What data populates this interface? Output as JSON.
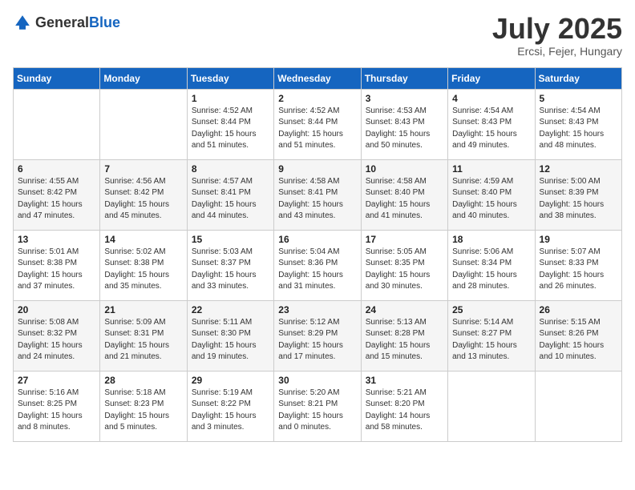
{
  "header": {
    "logo_general": "General",
    "logo_blue": "Blue",
    "month_title": "July 2025",
    "location": "Ercsi, Fejer, Hungary"
  },
  "days_of_week": [
    "Sunday",
    "Monday",
    "Tuesday",
    "Wednesday",
    "Thursday",
    "Friday",
    "Saturday"
  ],
  "weeks": [
    [
      {
        "day": "",
        "sunrise": "",
        "sunset": "",
        "daylight": ""
      },
      {
        "day": "",
        "sunrise": "",
        "sunset": "",
        "daylight": ""
      },
      {
        "day": "1",
        "sunrise": "Sunrise: 4:52 AM",
        "sunset": "Sunset: 8:44 PM",
        "daylight": "Daylight: 15 hours and 51 minutes."
      },
      {
        "day": "2",
        "sunrise": "Sunrise: 4:52 AM",
        "sunset": "Sunset: 8:44 PM",
        "daylight": "Daylight: 15 hours and 51 minutes."
      },
      {
        "day": "3",
        "sunrise": "Sunrise: 4:53 AM",
        "sunset": "Sunset: 8:43 PM",
        "daylight": "Daylight: 15 hours and 50 minutes."
      },
      {
        "day": "4",
        "sunrise": "Sunrise: 4:54 AM",
        "sunset": "Sunset: 8:43 PM",
        "daylight": "Daylight: 15 hours and 49 minutes."
      },
      {
        "day": "5",
        "sunrise": "Sunrise: 4:54 AM",
        "sunset": "Sunset: 8:43 PM",
        "daylight": "Daylight: 15 hours and 48 minutes."
      }
    ],
    [
      {
        "day": "6",
        "sunrise": "Sunrise: 4:55 AM",
        "sunset": "Sunset: 8:42 PM",
        "daylight": "Daylight: 15 hours and 47 minutes."
      },
      {
        "day": "7",
        "sunrise": "Sunrise: 4:56 AM",
        "sunset": "Sunset: 8:42 PM",
        "daylight": "Daylight: 15 hours and 45 minutes."
      },
      {
        "day": "8",
        "sunrise": "Sunrise: 4:57 AM",
        "sunset": "Sunset: 8:41 PM",
        "daylight": "Daylight: 15 hours and 44 minutes."
      },
      {
        "day": "9",
        "sunrise": "Sunrise: 4:58 AM",
        "sunset": "Sunset: 8:41 PM",
        "daylight": "Daylight: 15 hours and 43 minutes."
      },
      {
        "day": "10",
        "sunrise": "Sunrise: 4:58 AM",
        "sunset": "Sunset: 8:40 PM",
        "daylight": "Daylight: 15 hours and 41 minutes."
      },
      {
        "day": "11",
        "sunrise": "Sunrise: 4:59 AM",
        "sunset": "Sunset: 8:40 PM",
        "daylight": "Daylight: 15 hours and 40 minutes."
      },
      {
        "day": "12",
        "sunrise": "Sunrise: 5:00 AM",
        "sunset": "Sunset: 8:39 PM",
        "daylight": "Daylight: 15 hours and 38 minutes."
      }
    ],
    [
      {
        "day": "13",
        "sunrise": "Sunrise: 5:01 AM",
        "sunset": "Sunset: 8:38 PM",
        "daylight": "Daylight: 15 hours and 37 minutes."
      },
      {
        "day": "14",
        "sunrise": "Sunrise: 5:02 AM",
        "sunset": "Sunset: 8:38 PM",
        "daylight": "Daylight: 15 hours and 35 minutes."
      },
      {
        "day": "15",
        "sunrise": "Sunrise: 5:03 AM",
        "sunset": "Sunset: 8:37 PM",
        "daylight": "Daylight: 15 hours and 33 minutes."
      },
      {
        "day": "16",
        "sunrise": "Sunrise: 5:04 AM",
        "sunset": "Sunset: 8:36 PM",
        "daylight": "Daylight: 15 hours and 31 minutes."
      },
      {
        "day": "17",
        "sunrise": "Sunrise: 5:05 AM",
        "sunset": "Sunset: 8:35 PM",
        "daylight": "Daylight: 15 hours and 30 minutes."
      },
      {
        "day": "18",
        "sunrise": "Sunrise: 5:06 AM",
        "sunset": "Sunset: 8:34 PM",
        "daylight": "Daylight: 15 hours and 28 minutes."
      },
      {
        "day": "19",
        "sunrise": "Sunrise: 5:07 AM",
        "sunset": "Sunset: 8:33 PM",
        "daylight": "Daylight: 15 hours and 26 minutes."
      }
    ],
    [
      {
        "day": "20",
        "sunrise": "Sunrise: 5:08 AM",
        "sunset": "Sunset: 8:32 PM",
        "daylight": "Daylight: 15 hours and 24 minutes."
      },
      {
        "day": "21",
        "sunrise": "Sunrise: 5:09 AM",
        "sunset": "Sunset: 8:31 PM",
        "daylight": "Daylight: 15 hours and 21 minutes."
      },
      {
        "day": "22",
        "sunrise": "Sunrise: 5:11 AM",
        "sunset": "Sunset: 8:30 PM",
        "daylight": "Daylight: 15 hours and 19 minutes."
      },
      {
        "day": "23",
        "sunrise": "Sunrise: 5:12 AM",
        "sunset": "Sunset: 8:29 PM",
        "daylight": "Daylight: 15 hours and 17 minutes."
      },
      {
        "day": "24",
        "sunrise": "Sunrise: 5:13 AM",
        "sunset": "Sunset: 8:28 PM",
        "daylight": "Daylight: 15 hours and 15 minutes."
      },
      {
        "day": "25",
        "sunrise": "Sunrise: 5:14 AM",
        "sunset": "Sunset: 8:27 PM",
        "daylight": "Daylight: 15 hours and 13 minutes."
      },
      {
        "day": "26",
        "sunrise": "Sunrise: 5:15 AM",
        "sunset": "Sunset: 8:26 PM",
        "daylight": "Daylight: 15 hours and 10 minutes."
      }
    ],
    [
      {
        "day": "27",
        "sunrise": "Sunrise: 5:16 AM",
        "sunset": "Sunset: 8:25 PM",
        "daylight": "Daylight: 15 hours and 8 minutes."
      },
      {
        "day": "28",
        "sunrise": "Sunrise: 5:18 AM",
        "sunset": "Sunset: 8:23 PM",
        "daylight": "Daylight: 15 hours and 5 minutes."
      },
      {
        "day": "29",
        "sunrise": "Sunrise: 5:19 AM",
        "sunset": "Sunset: 8:22 PM",
        "daylight": "Daylight: 15 hours and 3 minutes."
      },
      {
        "day": "30",
        "sunrise": "Sunrise: 5:20 AM",
        "sunset": "Sunset: 8:21 PM",
        "daylight": "Daylight: 15 hours and 0 minutes."
      },
      {
        "day": "31",
        "sunrise": "Sunrise: 5:21 AM",
        "sunset": "Sunset: 8:20 PM",
        "daylight": "Daylight: 14 hours and 58 minutes."
      },
      {
        "day": "",
        "sunrise": "",
        "sunset": "",
        "daylight": ""
      },
      {
        "day": "",
        "sunrise": "",
        "sunset": "",
        "daylight": ""
      }
    ]
  ]
}
